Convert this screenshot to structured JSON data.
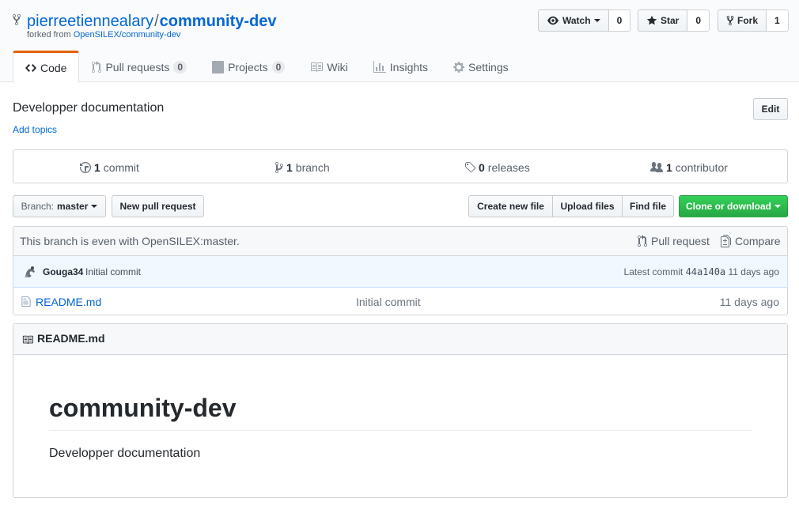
{
  "repo": {
    "owner": "pierreetiennealary",
    "separator": "/",
    "name": "community-dev",
    "forked_prefix": "forked from",
    "forked_from": "OpenSILEX/community-dev",
    "description": "Developper documentation",
    "add_topics": "Add topics",
    "edit_label": "Edit"
  },
  "actions": {
    "watch": {
      "label": "Watch",
      "count": "0"
    },
    "star": {
      "label": "Star",
      "count": "0"
    },
    "fork": {
      "label": "Fork",
      "count": "1"
    }
  },
  "tabs": [
    {
      "label": "Code",
      "icon": "code-icon",
      "counter": ""
    },
    {
      "label": "Pull requests",
      "icon": "pull-request-icon",
      "counter": "0"
    },
    {
      "label": "Projects",
      "icon": "project-icon",
      "counter": "0"
    },
    {
      "label": "Wiki",
      "icon": "book-icon",
      "counter": ""
    },
    {
      "label": "Insights",
      "icon": "graph-icon",
      "counter": ""
    },
    {
      "label": "Settings",
      "icon": "gear-icon",
      "counter": ""
    }
  ],
  "summary": {
    "commits": {
      "count": "1",
      "label": "commit"
    },
    "branches": {
      "count": "1",
      "label": "branch"
    },
    "releases": {
      "count": "0",
      "label": "releases"
    },
    "contributors": {
      "count": "1",
      "label": "contributor"
    }
  },
  "file_nav": {
    "branch_prefix": "Branch:",
    "branch": "master",
    "new_pull_request": "New pull request",
    "create_new_file": "Create new file",
    "upload_files": "Upload files",
    "find_file": "Find file",
    "clone_or_download": "Clone or download"
  },
  "branch_info": {
    "message": "This branch is even with OpenSILEX:master.",
    "pull_request": "Pull request",
    "compare": "Compare"
  },
  "latest_commit": {
    "author": "Gouga34",
    "message": "Initial commit",
    "prefix": "Latest commit",
    "sha": "44a140a",
    "age": "11 days ago"
  },
  "files": [
    {
      "name": "README.md",
      "message": "Initial commit",
      "age": "11 days ago"
    }
  ],
  "readme": {
    "header": "README.md",
    "heading": "community-dev",
    "body": "Developper documentation"
  },
  "colors": {
    "link": "#0366d6",
    "tab_accent": "#e36209",
    "primary_button": "#28a745"
  }
}
